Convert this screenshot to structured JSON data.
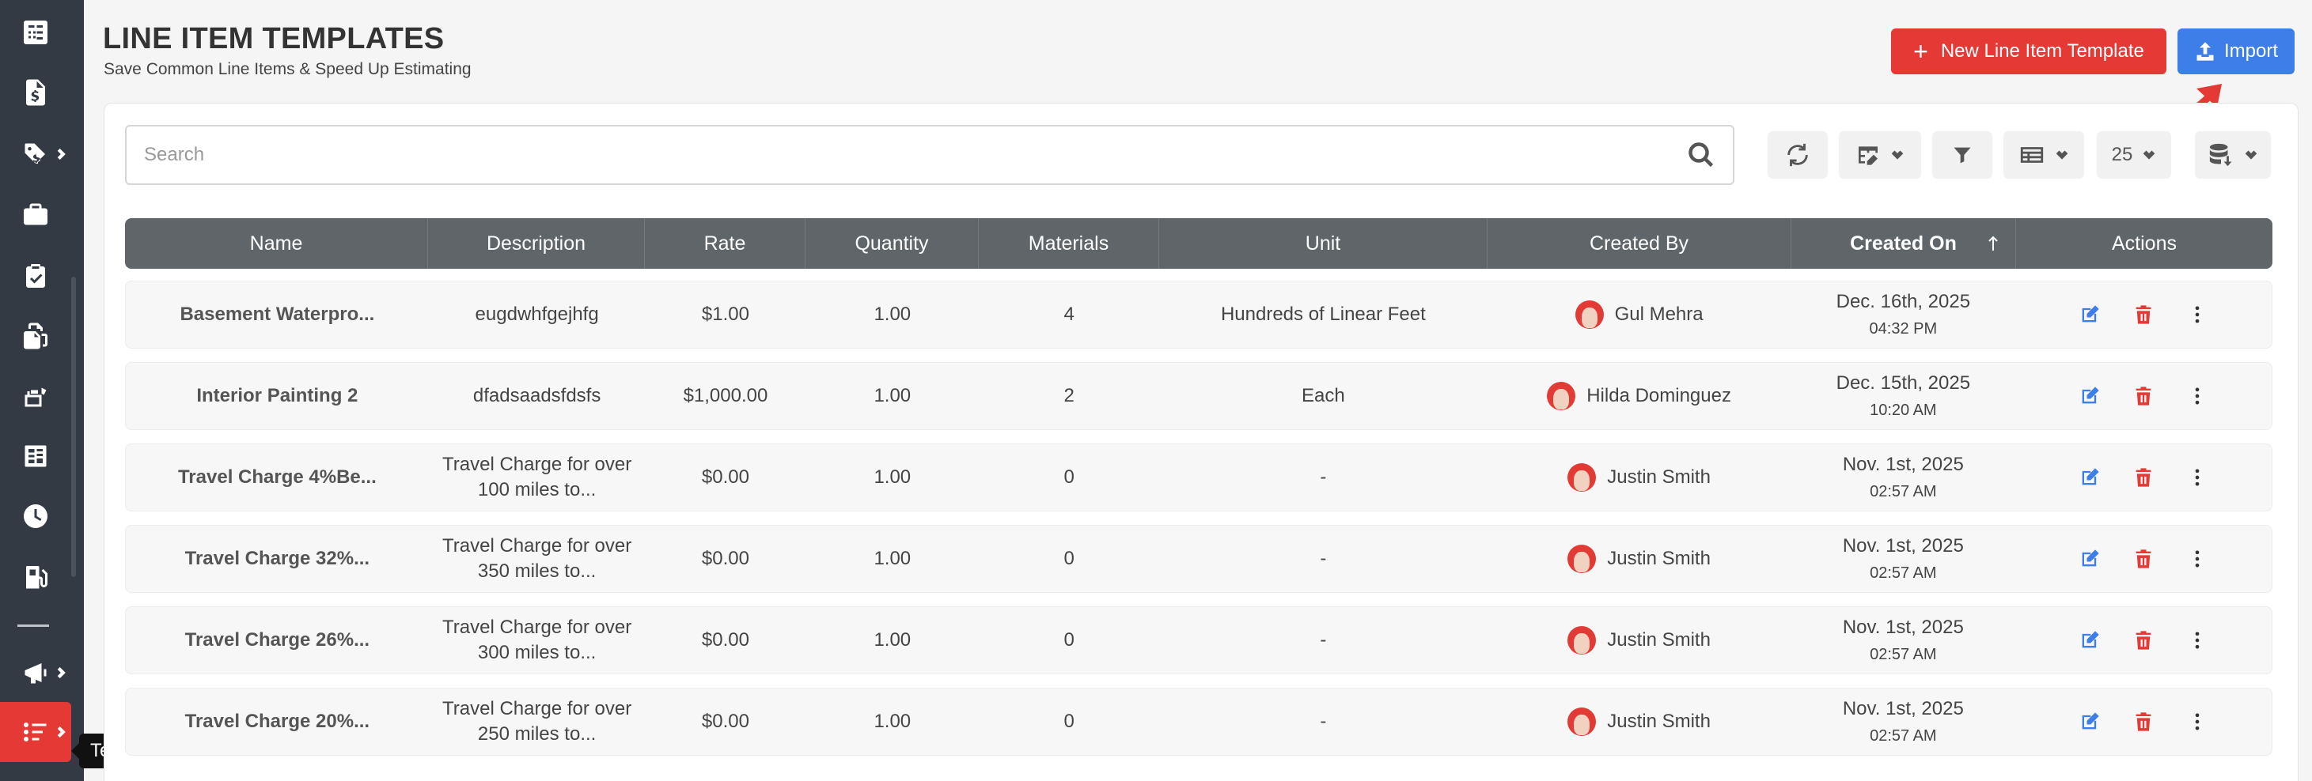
{
  "app": {
    "page_title": "LINE ITEM TEMPLATES",
    "page_subtitle": "Save Common Line Items & Speed Up Estimating",
    "new_button_label": "New Line Item Template",
    "import_button_label": "Import",
    "tooltip": "Templates",
    "accent_color": "#e53935",
    "import_color": "#3d7ee8"
  },
  "sidebar": {
    "items": [
      {
        "icon": "calculator-icon"
      },
      {
        "icon": "invoice-dollar-icon"
      },
      {
        "icon": "product-tag-icon"
      },
      {
        "icon": "briefcase-icon"
      },
      {
        "icon": "clipboard-check-icon"
      },
      {
        "icon": "files-icon"
      },
      {
        "icon": "tools-icon"
      },
      {
        "icon": "report-icon"
      },
      {
        "icon": "clock-icon"
      },
      {
        "icon": "gas-pump-icon"
      },
      {
        "icon": "megaphone-icon"
      },
      {
        "icon": "templates-icon"
      }
    ]
  },
  "search": {
    "placeholder": "Search"
  },
  "toolbar": {
    "page_size": "25"
  },
  "table": {
    "columns": [
      "Name",
      "Description",
      "Rate",
      "Quantity",
      "Materials",
      "Unit",
      "Created By",
      "Created On",
      "Actions"
    ],
    "sorted_column": "Created On",
    "rows": [
      {
        "name": "Basement Waterpro...",
        "description": "eugdwhfgejhfg",
        "rate": "$1.00",
        "quantity": "1.00",
        "materials": "4",
        "unit": "Hundreds of Linear Feet",
        "created_by": "Gul Mehra",
        "created_date": "Dec. 16th, 2025",
        "created_time": "04:32 PM"
      },
      {
        "name": "Interior Painting 2",
        "description": "dfadsaadsfdsfs",
        "rate": "$1,000.00",
        "quantity": "1.00",
        "materials": "2",
        "unit": "Each",
        "created_by": "Hilda Dominguez",
        "created_date": "Dec. 15th, 2025",
        "created_time": "10:20 AM"
      },
      {
        "name": "Travel Charge 4%Be...",
        "description": "Travel Charge for over 100 miles to...",
        "rate": "$0.00",
        "quantity": "1.00",
        "materials": "0",
        "unit": "-",
        "created_by": "Justin Smith",
        "created_date": "Nov. 1st, 2025",
        "created_time": "02:57 AM"
      },
      {
        "name": "Travel Charge 32%...",
        "description": "Travel Charge for over 350 miles to...",
        "rate": "$0.00",
        "quantity": "1.00",
        "materials": "0",
        "unit": "-",
        "created_by": "Justin Smith",
        "created_date": "Nov. 1st, 2025",
        "created_time": "02:57 AM"
      },
      {
        "name": "Travel Charge 26%...",
        "description": "Travel Charge for over 300 miles to...",
        "rate": "$0.00",
        "quantity": "1.00",
        "materials": "0",
        "unit": "-",
        "created_by": "Justin Smith",
        "created_date": "Nov. 1st, 2025",
        "created_time": "02:57 AM"
      },
      {
        "name": "Travel Charge 20%...",
        "description": "Travel Charge for over 250 miles to...",
        "rate": "$0.00",
        "quantity": "1.00",
        "materials": "0",
        "unit": "-",
        "created_by": "Justin Smith",
        "created_date": "Nov. 1st, 2025",
        "created_time": "02:57 AM"
      }
    ]
  }
}
